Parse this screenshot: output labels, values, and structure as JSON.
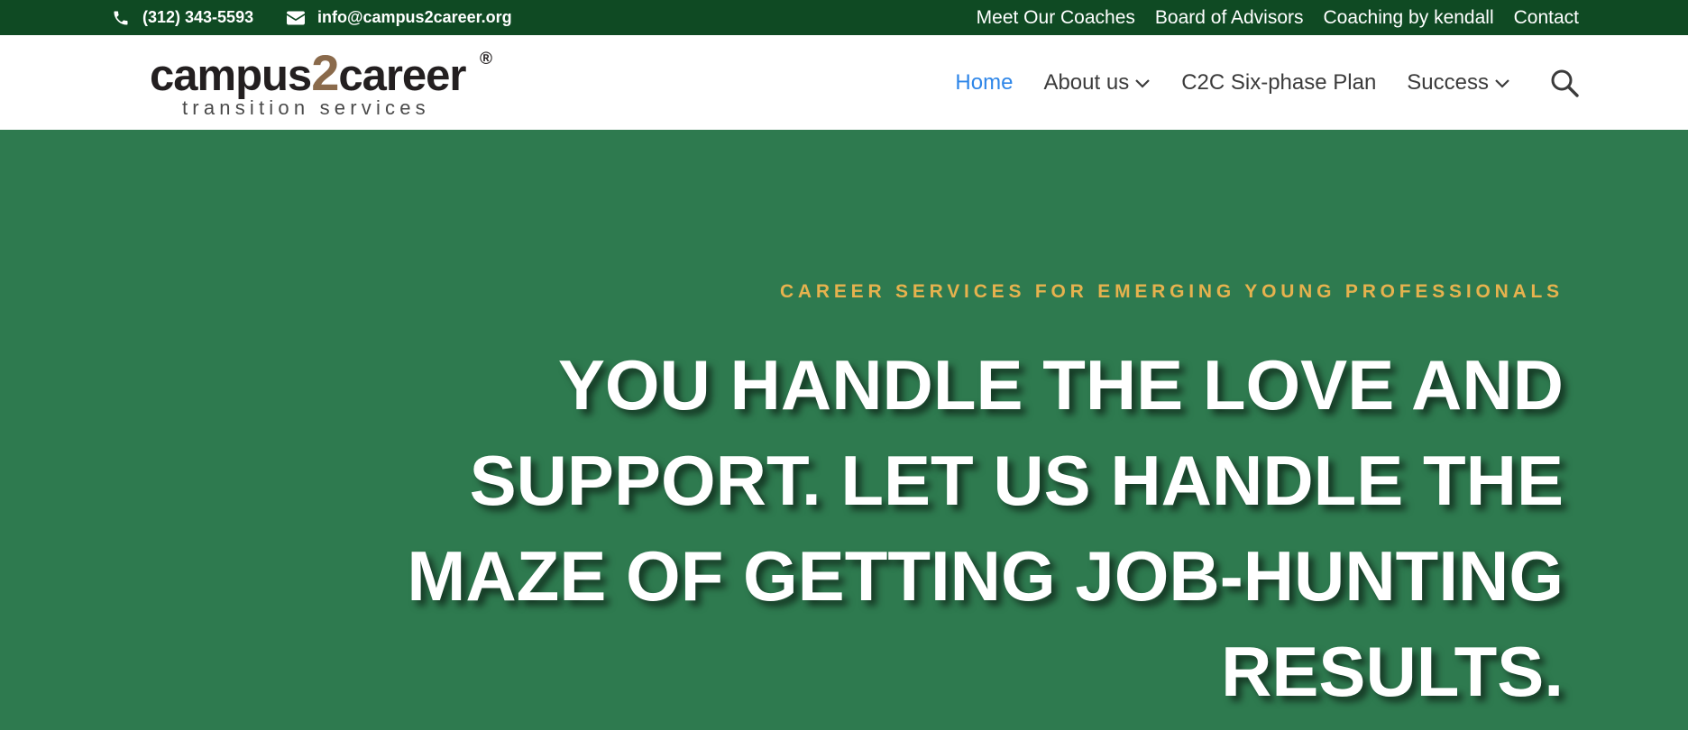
{
  "topbar": {
    "phone": "(312) 343-5593",
    "email": "info@campus2career.org",
    "links": [
      "Meet Our Coaches",
      "Board of Advisors",
      "Coaching by kendall",
      "Contact"
    ],
    "background": "#0f4a23"
  },
  "logo": {
    "prefix": "campus",
    "two": "2",
    "suffix": "career",
    "registered": "®",
    "tagline": "transition services"
  },
  "nav": {
    "home": "Home",
    "about": "About us",
    "plan": "C2C Six-phase Plan",
    "success": "Success",
    "search_icon": "search-icon",
    "active_color": "#2e86e8"
  },
  "hero": {
    "eyebrow": "CAREER SERVICES FOR EMERGING YOUNG PROFESSIONALS",
    "headline": "YOU HANDLE THE LOVE AND SUPPORT. LET US HANDLE THE MAZE OF GETTING JOB-HUNTING RESULTS.",
    "background": "#2e7a4f",
    "eyebrow_color": "#e6b24e"
  }
}
